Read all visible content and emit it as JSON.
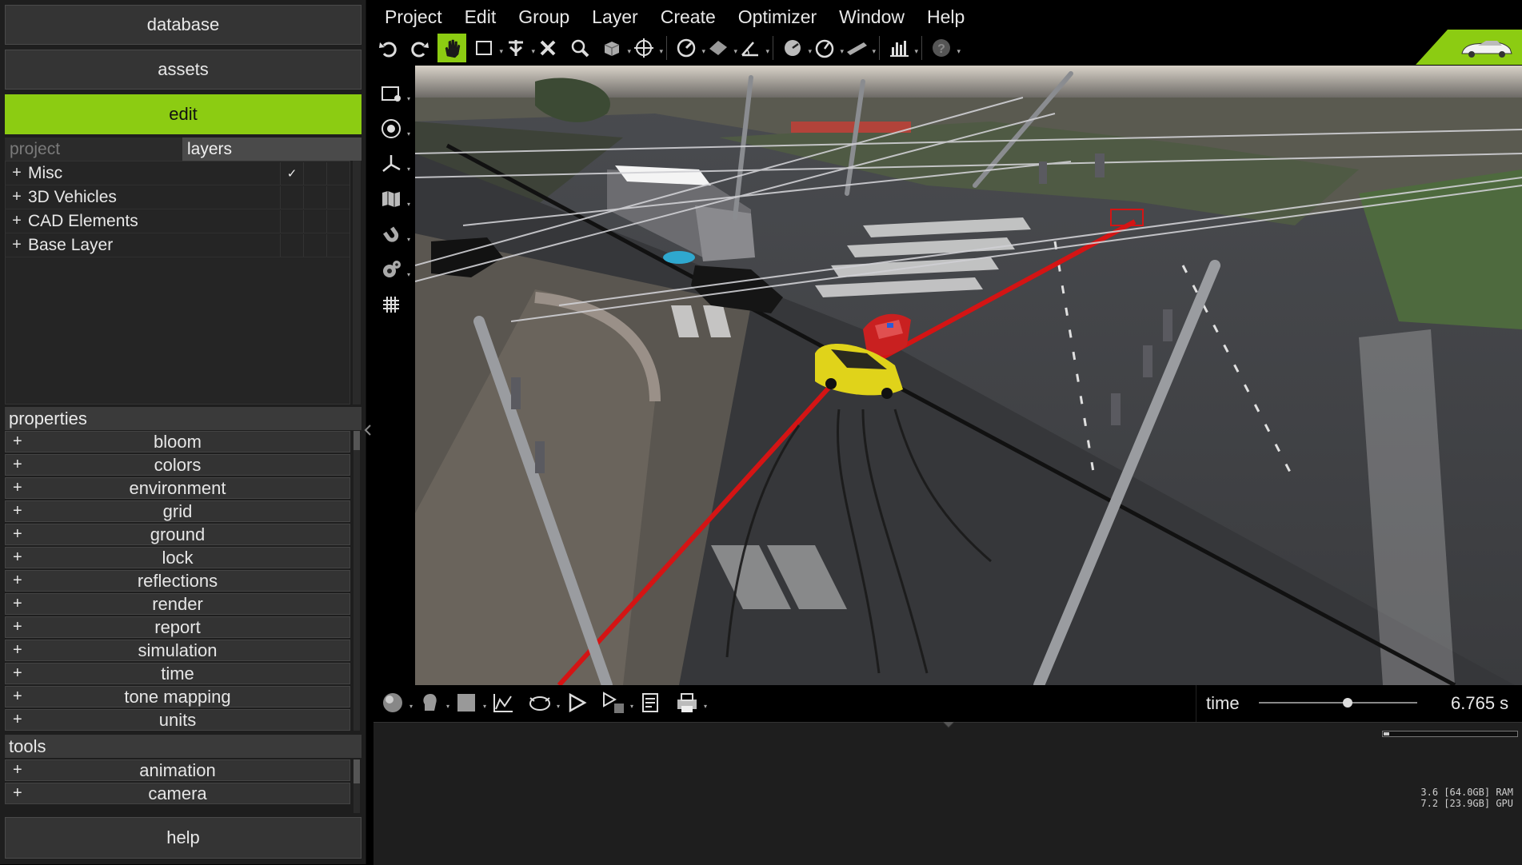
{
  "left_panel": {
    "buttons": {
      "database": "database",
      "assets": "assets",
      "edit": "edit",
      "help": "help"
    },
    "tabs": {
      "project": "project",
      "layers": "layers"
    },
    "layers": [
      {
        "label": "Misc",
        "checked": true
      },
      {
        "label": "3D Vehicles",
        "checked": false
      },
      {
        "label": "CAD Elements",
        "checked": false
      },
      {
        "label": "Base Layer",
        "checked": false
      }
    ],
    "properties_title": "properties",
    "properties": [
      "bloom",
      "colors",
      "environment",
      "grid",
      "ground",
      "lock",
      "reflections",
      "render",
      "report",
      "simulation",
      "time",
      "tone mapping",
      "units"
    ],
    "tools_title": "tools",
    "tools": [
      "animation",
      "camera"
    ],
    "plus": "+",
    "check": "✓"
  },
  "menu": [
    "Project",
    "Edit",
    "Group",
    "Layer",
    "Create",
    "Optimizer",
    "Window",
    "Help"
  ],
  "toolbar_icons": [
    "undo-icon",
    "redo-icon",
    "pan-hand-icon",
    "select-box-icon",
    "multi-select-icon",
    "delete-icon",
    "zoom-icon",
    "cube-icon",
    "move-icon",
    "measure-icon",
    "surface-icon",
    "angle-icon",
    "gauge-icon",
    "speed-icon",
    "ruler-icon",
    "bar-chart-icon",
    "help-icon"
  ],
  "colors": {
    "accent": "#8ccc12",
    "panel": "#1e1e1e",
    "row": "#333333"
  },
  "bottom": {
    "time_label": "time",
    "time_value": "6.765 s",
    "time_position": 0.56
  },
  "status": {
    "ram": "3.6 [64.0GB] RAM",
    "gpu": "7.2 [23.9GB] GPU",
    "progress": 0.04
  }
}
